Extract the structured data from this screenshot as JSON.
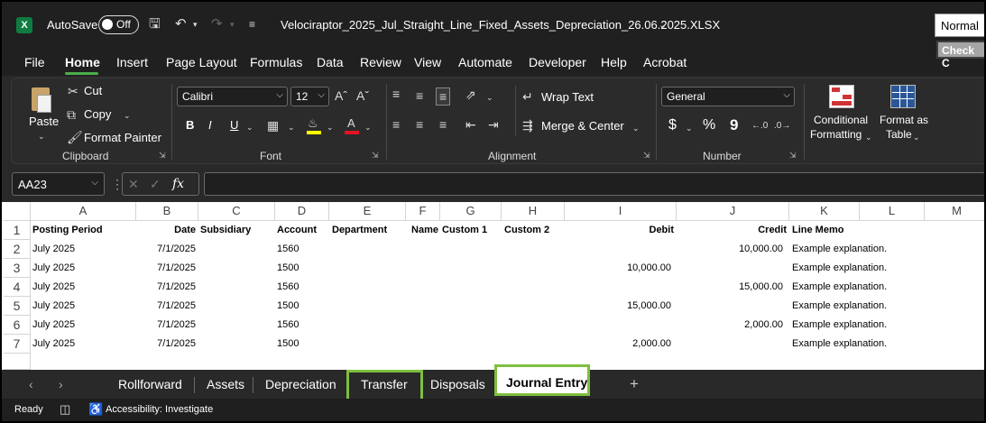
{
  "title_bar": {
    "app_icon": "excel-icon",
    "autosave_label": "AutoSave",
    "autosave_state": "Off",
    "document_title": "Velociraptor_2025_Jul_Straight_Line_Fixed_Assets_Depreciation_26.06.2025.XLSX"
  },
  "menu": {
    "items": [
      "File",
      "Home",
      "Insert",
      "Page Layout",
      "Formulas",
      "Data",
      "Review",
      "View",
      "Automate",
      "Developer",
      "Help",
      "Acrobat"
    ],
    "active": "Home"
  },
  "ribbon": {
    "clipboard": {
      "label": "Clipboard",
      "paste": "Paste",
      "cut": "Cut",
      "copy": "Copy",
      "format_painter": "Format Painter"
    },
    "font": {
      "label": "Font",
      "font_name": "Calibri",
      "font_size": "12",
      "bold": "B",
      "italic": "I",
      "underline": "U"
    },
    "alignment": {
      "label": "Alignment",
      "wrap_text": "Wrap Text",
      "merge_center": "Merge & Center"
    },
    "number": {
      "label": "Number",
      "format": "General",
      "currency": "$",
      "percent": "%",
      "comma": "9"
    },
    "styles": {
      "conditional_formatting_line1": "Conditional",
      "conditional_formatting_line2": "Formatting",
      "format_as_table_line1": "Format as",
      "format_as_table_line2": "Table",
      "normal": "Normal",
      "check_cell": "Check C"
    }
  },
  "formula_bar": {
    "name_box": "AA23",
    "fx": "fx",
    "formula": ""
  },
  "grid": {
    "columns": [
      "A",
      "B",
      "C",
      "D",
      "E",
      "F",
      "G",
      "H",
      "I",
      "J",
      "K",
      "L",
      "M"
    ],
    "row_numbers": [
      "1",
      "2",
      "3",
      "4",
      "5",
      "6",
      "7"
    ],
    "headers": {
      "posting_period": "Posting Period",
      "date": "Date",
      "subsidiary": "Subsidiary",
      "account": "Account",
      "department": "Department",
      "name": "Name",
      "custom1": "Custom 1",
      "custom2": "Custom 2",
      "debit": "Debit",
      "credit": "Credit",
      "line_memo": "Line Memo"
    },
    "rows": [
      {
        "period": "July 2025",
        "date": "7/1/2025",
        "account": "1560",
        "debit": "",
        "credit": "10,000.00",
        "memo": "Example explanation."
      },
      {
        "period": "July 2025",
        "date": "7/1/2025",
        "account": "1500",
        "debit": "10,000.00",
        "credit": "",
        "memo": "Example explanation."
      },
      {
        "period": "July 2025",
        "date": "7/1/2025",
        "account": "1560",
        "debit": "",
        "credit": "15,000.00",
        "memo": "Example explanation."
      },
      {
        "period": "July 2025",
        "date": "7/1/2025",
        "account": "1500",
        "debit": "15,000.00",
        "credit": "",
        "memo": "Example explanation."
      },
      {
        "period": "July 2025",
        "date": "7/1/2025",
        "account": "1560",
        "debit": "",
        "credit": "2,000.00",
        "memo": "Example explanation."
      },
      {
        "period": "July 2025",
        "date": "7/1/2025",
        "account": "1500",
        "debit": "2,000.00",
        "credit": "",
        "memo": "Example explanation."
      }
    ]
  },
  "sheet_tabs": {
    "tabs": [
      "Rollforward",
      "Assets",
      "Depreciation",
      "Transfer",
      "Disposals",
      "Journal Entry"
    ],
    "active": "Journal Entry",
    "highlighted": [
      "Transfer",
      "Journal Entry"
    ],
    "add": "+"
  },
  "status_bar": {
    "ready": "Ready",
    "accessibility": "Accessibility: Investigate"
  },
  "colors": {
    "excel_green": "#107c41",
    "highlight_green": "#7fbf3f",
    "dark_bg": "#292929"
  }
}
